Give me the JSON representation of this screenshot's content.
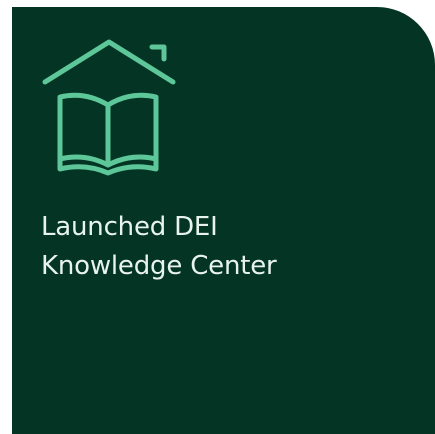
{
  "card": {
    "title_lines": [
      "Launched DEI",
      "Knowledge Center"
    ],
    "icon": "house-book-icon",
    "colors": {
      "background": "#033424",
      "icon": "#5ec79a",
      "text": "#e8f3ee"
    }
  }
}
